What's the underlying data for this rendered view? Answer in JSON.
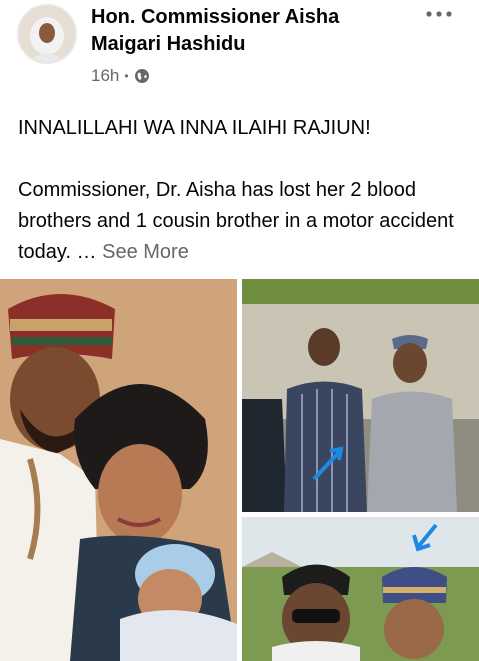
{
  "post": {
    "author": "Hon. Commissioner Aisha Maigari Hashidu",
    "time": "16h",
    "separator": "•",
    "privacy_icon": "globe-icon",
    "more_icon": "more-options-icon",
    "line1": "INNALILLAHI WA INNA ILAIHI RAJIUN!",
    "line2": "Commissioner,  Dr. Aisha has lost her 2 blood brothers and 1 cousin brother in a motor accident today. …",
    "see_more": "See More"
  },
  "photos": [
    {
      "name": "photo-couple-with-baby"
    },
    {
      "name": "photo-two-men-standing"
    },
    {
      "name": "photo-two-men-outdoors"
    }
  ],
  "colors": {
    "text": "#050505",
    "secondary": "#65676b",
    "arrow_blue": "#1e88e5"
  }
}
